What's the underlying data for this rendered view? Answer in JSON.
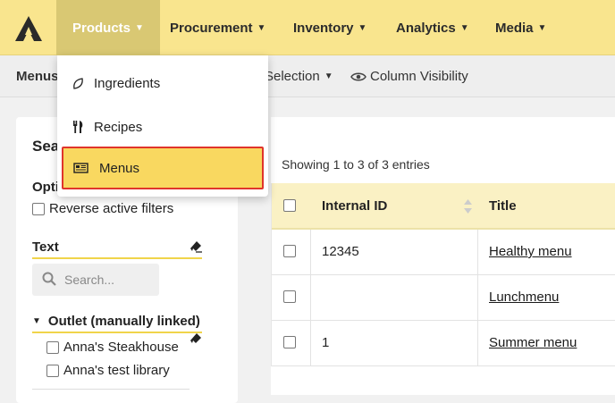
{
  "nav": {
    "items": [
      {
        "label": "Products",
        "active": true
      },
      {
        "label": "Procurement"
      },
      {
        "label": "Inventory"
      },
      {
        "label": "Analytics"
      },
      {
        "label": "Media"
      }
    ]
  },
  "dropdown": {
    "items": [
      {
        "label": "Ingredients",
        "icon": "leaf-icon"
      },
      {
        "label": "Recipes",
        "icon": "utensils-icon"
      },
      {
        "label": "Menus",
        "icon": "newspaper-icon",
        "selected": true
      }
    ]
  },
  "subbar": {
    "page_label": "Menus",
    "selection_label": "Selection",
    "column_visibility_label": "Column Visibility"
  },
  "filters": {
    "title_fragment": "Sea",
    "options_fragment": "Opti",
    "reverse_filters_label": "Reverse active filters",
    "text_label": "Text",
    "search_placeholder": "Search...",
    "outlet_label": "Outlet (manually linked)",
    "outlets": [
      "Anna's Steakhouse",
      "Anna's test library"
    ]
  },
  "table": {
    "info": "Showing 1 to 3 of 3 entries",
    "headers": {
      "internal_id": "Internal ID",
      "title": "Title"
    },
    "rows": [
      {
        "internal_id": "12345",
        "title": "Healthy menu"
      },
      {
        "internal_id": "",
        "title": "Lunchmenu"
      },
      {
        "internal_id": "1",
        "title": "Summer menu"
      }
    ]
  },
  "colors": {
    "nav_bg": "#f9e58e",
    "nav_active": "#d9c873",
    "selected_bg": "#f9d860",
    "selected_border": "#e0352b",
    "header_bg": "#faf1c4"
  }
}
